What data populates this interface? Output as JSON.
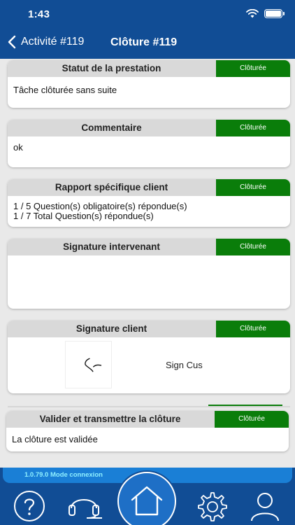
{
  "status": {
    "time": "1:43"
  },
  "nav": {
    "back_label": "Activité #119",
    "title": "Clôture #119"
  },
  "cards": [
    {
      "title": "Statut de la prestation",
      "badge": "Clôturée",
      "body": [
        "Tâche clôturée sans suite"
      ]
    },
    {
      "title": "Commentaire",
      "badge": "Clôturée",
      "body": [
        "ok"
      ]
    },
    {
      "title": "Rapport spécifique client",
      "badge": "Clôturée",
      "body": [
        "1 / 5 Question(s) obligatoire(s) répondue(s)",
        "1 / 7 Total Question(s) répondue(s)"
      ]
    },
    {
      "title": "Signature intervenant",
      "badge": "Clôturée",
      "body": []
    },
    {
      "title": "Signature client",
      "badge": "Clôturée",
      "signer": "Sign Cus"
    },
    {
      "title": "Valider et transmettre la clôture",
      "badge": "Clôturée",
      "body": [
        "La clôture est validée"
      ]
    }
  ],
  "footer": {
    "version": "1.0.79.0 Mode connexion",
    "tabs": [
      "help-icon",
      "headset-icon",
      "home-icon",
      "gear-icon",
      "user-icon"
    ]
  },
  "colors": {
    "nav_blue": "#114d95",
    "badge_green": "#0a7d0a",
    "version_strip": "#1a7fd6",
    "version_text": "#8ff0ff"
  }
}
